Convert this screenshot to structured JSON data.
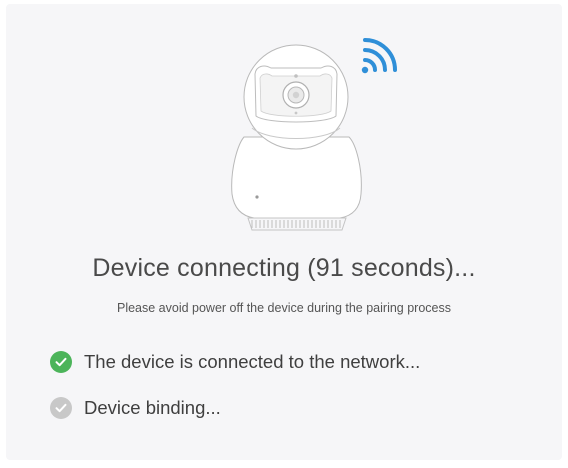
{
  "status": {
    "title": "Device connecting (91 seconds)...",
    "subtitle": "Please avoid power off the device during the pairing process"
  },
  "steps": [
    {
      "label": "The device is connected to the network...",
      "state": "done",
      "icon": "check-circle-icon"
    },
    {
      "label": "Device binding...",
      "state": "pending",
      "icon": "check-circle-icon"
    }
  ],
  "illustration": {
    "device": "security-camera-icon",
    "signal": "wifi-signal-icon"
  },
  "colors": {
    "background": "#f6f6f8",
    "signal": "#2f8fd8",
    "done": "#4cb45a",
    "pending": "#c8c8c8",
    "text": "#4a4a4a"
  }
}
